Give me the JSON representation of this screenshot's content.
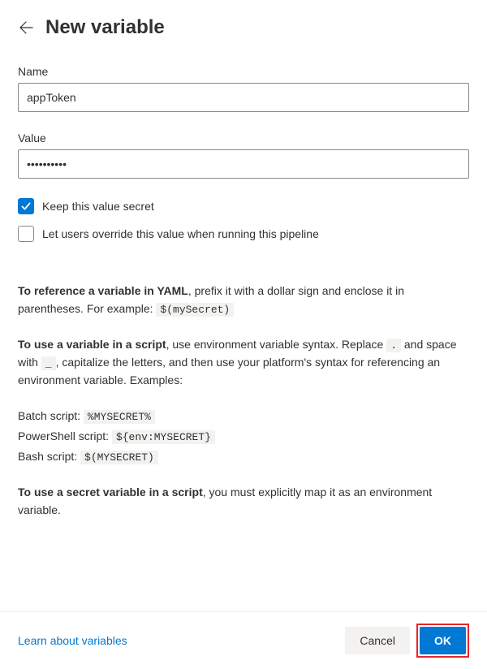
{
  "header": {
    "title": "New variable"
  },
  "fields": {
    "name": {
      "label": "Name",
      "value": "appToken"
    },
    "value": {
      "label": "Value",
      "value": "••••••••••"
    }
  },
  "checkboxes": {
    "secret": {
      "label": "Keep this value secret",
      "checked": true
    },
    "override": {
      "label": "Let users override this value when running this pipeline",
      "checked": false
    }
  },
  "help": {
    "yaml": {
      "bold": "To reference a variable in YAML",
      "rest": ", prefix it with a dollar sign and enclose it in parentheses. For example: ",
      "code": "$(mySecret)"
    },
    "script": {
      "bold": "To use a variable in a script",
      "part1": ", use environment variable syntax. Replace ",
      "code_dot": ".",
      "part2": " and space with ",
      "code_underscore": "_",
      "part3": ", capitalize the letters, and then use your platform's syntax for referencing an environment variable. Examples:"
    },
    "examples": {
      "batch": {
        "label": "Batch script: ",
        "code": "%MYSECRET%"
      },
      "powershell": {
        "label": "PowerShell script: ",
        "code": "${env:MYSECRET}"
      },
      "bash": {
        "label": "Bash script: ",
        "code": "$(MYSECRET)"
      }
    },
    "secret_note": {
      "bold": "To use a secret variable in a script",
      "rest": ", you must explicitly map it as an environment variable."
    }
  },
  "footer": {
    "learn_link": "Learn about variables",
    "cancel": "Cancel",
    "ok": "OK"
  }
}
